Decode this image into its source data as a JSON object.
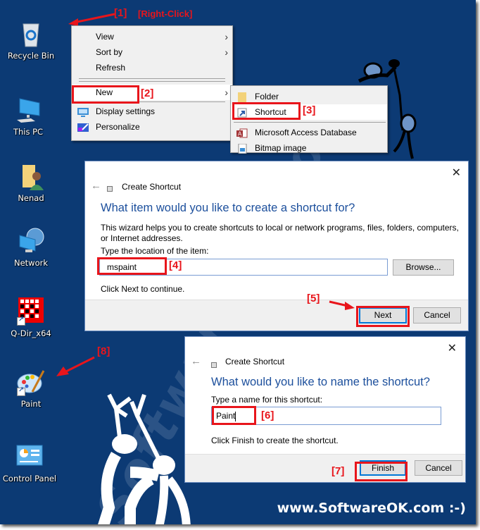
{
  "desktop": {
    "icons": [
      {
        "label": "Recycle Bin",
        "icon": "recycle-bin-icon"
      },
      {
        "label": "This PC",
        "icon": "this-pc-icon"
      },
      {
        "label": "Nenad",
        "icon": "user-folder-icon"
      },
      {
        "label": "Network",
        "icon": "network-icon"
      },
      {
        "label": "Q-Dir_x64",
        "icon": "qdir-icon",
        "shortcut": true
      },
      {
        "label": "Paint",
        "icon": "paint-icon",
        "shortcut": true
      },
      {
        "label": "Control Panel",
        "icon": "control-panel-icon"
      }
    ],
    "background_color": "#0c3a74",
    "watermark": "SoftwareOK.com",
    "brand_footer": "www.SoftwareOK.com :-)"
  },
  "annotations": {
    "step1": "[1]",
    "step1_note": "[Right-Click]",
    "step2": "[2]",
    "step3": "[3]",
    "step4": "[4]",
    "step5": "[5]",
    "step6": "[6]",
    "step7": "[7]",
    "step8": "[8]",
    "color": "#e8151b"
  },
  "context_menu": {
    "items": [
      {
        "label": "View",
        "submenu": true
      },
      {
        "label": "Sort by",
        "submenu": true
      },
      {
        "label": "Refresh"
      },
      {
        "label": "New",
        "submenu": true,
        "highlighted": true
      },
      {
        "label": "Display settings",
        "icon": "display-settings-icon"
      },
      {
        "label": "Personalize",
        "icon": "personalize-icon"
      }
    ]
  },
  "new_submenu": {
    "items": [
      {
        "label": "Folder",
        "icon": "folder-icon"
      },
      {
        "label": "Shortcut",
        "icon": "shortcut-icon",
        "highlighted": true
      },
      {
        "label": "Microsoft Access Database",
        "icon": "access-icon"
      },
      {
        "label": "Bitmap image",
        "icon": "bitmap-icon"
      }
    ]
  },
  "dialog1": {
    "title": "Create Shortcut",
    "heading": "What item would you like to create a shortcut for?",
    "description": "This wizard helps you to create shortcuts to local or network programs, files, folders, computers, or Internet addresses.",
    "field_label": "Type the location of the item:",
    "field_value": "mspaint",
    "browse_label": "Browse...",
    "hint": "Click Next to continue.",
    "next_label": "Next",
    "cancel_label": "Cancel"
  },
  "dialog2": {
    "title": "Create Shortcut",
    "heading": "What would you like to name the shortcut?",
    "field_label": "Type a name for this shortcut:",
    "field_value": "Paint",
    "hint": "Click Finish to create the shortcut.",
    "finish_label": "Finish",
    "cancel_label": "Cancel"
  }
}
